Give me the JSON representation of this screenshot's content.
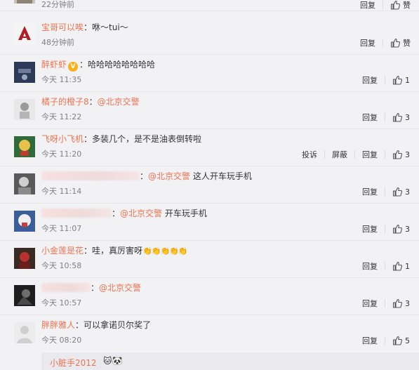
{
  "actions": {
    "reply": "回复",
    "like": "赞",
    "report": "投诉",
    "block": "屏蔽"
  },
  "comments": [
    {
      "name": "",
      "text": "",
      "time": "22分钟前",
      "likes": "赞"
    },
    {
      "name": "宝哥可以唉",
      "text": "咻～tui～",
      "time": "48分钟前",
      "likes": "赞"
    },
    {
      "name": "醉虾虾",
      "badge": "V",
      "text": "哈哈哈哈哈哈哈哈",
      "time": "今天 11:35",
      "likes": "1"
    },
    {
      "name": "橘子的橙子8",
      "mention": "@北京交警",
      "text": "",
      "time": "今天 11:22",
      "likes": "3"
    },
    {
      "name": "飞呀小飞机",
      "text": "多装几个，是不是油表倒转啦",
      "time": "今天 11:20",
      "likes": "3"
    },
    {
      "name": "",
      "mention": "@北京交警",
      "text": "这人开车玩手机",
      "time": "今天 11:14",
      "likes": "3"
    },
    {
      "name": "",
      "mention": "@北京交警",
      "text": "开车玩手机",
      "time": "今天 11:07",
      "likes": "3"
    },
    {
      "name": "小金莲是花",
      "text": "哇，真厉害呀",
      "emoji": "👏👏👏👏👏",
      "time": "今天 10:58",
      "likes": "1"
    },
    {
      "name": "",
      "mention": "@北京交警",
      "text": "",
      "time": "今天 10:57",
      "likes": "3"
    },
    {
      "name": "胖胖雅人",
      "text": "可以拿诺贝尔奖了",
      "time": "今天 08:20",
      "likes": "5"
    }
  ],
  "sub_reply": {
    "name": "小脏手2012",
    "emoji": "🐱🐼"
  }
}
